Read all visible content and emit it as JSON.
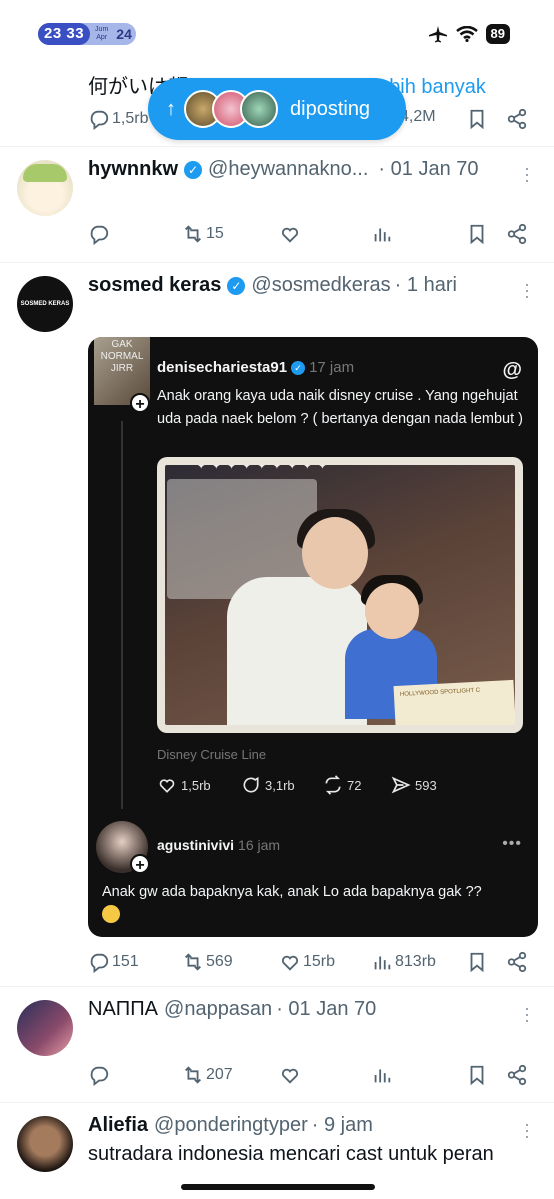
{
  "status": {
    "time": "23 33",
    "month_day_top": "Jum",
    "month_day_bottom": "Apr",
    "date": "24",
    "battery": "89"
  },
  "top_tweet": {
    "text": "何がいは都い。て",
    "translate_link": "Terjemahkan lebih banyak",
    "replies": "1,5rb",
    "views": "4,2M"
  },
  "new_posts_pill": {
    "label": "diposting"
  },
  "tweets": [
    {
      "name": "hywnnkw",
      "handle": "@heywannakno...",
      "time": "· 01 Jan 70",
      "retweets": "15"
    },
    {
      "name": "sosmed keras",
      "avatar_text": "SOSMED KERAS",
      "handle": "@sosmedkeras",
      "time": "· 1 hari",
      "replies": "151",
      "retweets": "569",
      "likes": "15rb",
      "views": "813rb",
      "embed": {
        "avatar_text": "GAK NORMAL JIRR",
        "username": "denisechariesta91",
        "time": "17 jam",
        "text": "Anak orang kaya uda naik disney cruise . Yang ngehujat uda pada naek belom ? ( bertanya dengan nada lembut )",
        "photo_cert": "HOLLYWOOD SPOTLIGHT C",
        "caption": "Disney Cruise Line",
        "likes": "1,5rb",
        "comments": "3,1rb",
        "reposts": "72",
        "shares": "593",
        "reply_user": "agustinivivi",
        "reply_time": "16 jam",
        "reply_text": "Anak gw ada bapaknya kak, anak Lo ada bapaknya gak ??"
      }
    },
    {
      "name": "ΝΑΠΠΑ",
      "handle": "@nappasan",
      "time": "· 01 Jan 70",
      "retweets": "207"
    },
    {
      "name": "Aliefia",
      "handle": "@ponderingtyper",
      "time": "· 9 jam",
      "text": "sutradara indonesia mencari cast untuk peran"
    }
  ]
}
